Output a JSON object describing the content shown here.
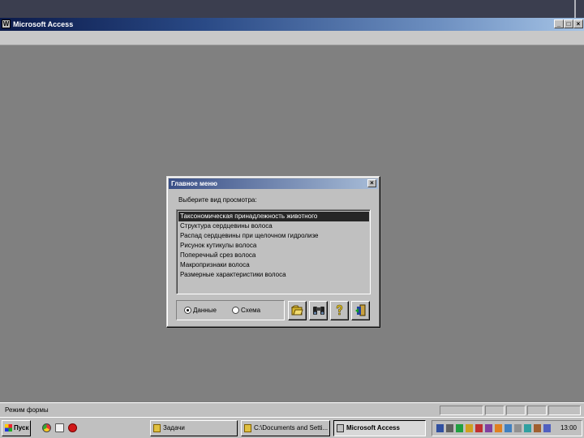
{
  "app": {
    "title": "Microsoft Access",
    "icon_text": "W",
    "buttons": [
      "_",
      "□",
      "×"
    ]
  },
  "dialog": {
    "title": "Главное меню",
    "close": "×",
    "prompt": "Выберите вид просмотра:",
    "items": [
      "Таксономическая принадлежность животного",
      "Структура сердцевины волоса",
      "Распад сердцевины при щелочном гидролизе",
      "Рисунок кутикулы волоса",
      "Поперечный срез волоса",
      "Макропризнаки волоса",
      "Размерные характеристики волоса"
    ],
    "selected_index": 0,
    "radios": [
      {
        "label": "Данные",
        "checked": true
      },
      {
        "label": "Схема",
        "checked": false
      }
    ],
    "tool_icons": [
      "open-folder-icon",
      "binoculars-icon",
      "help-icon",
      "exit-door-icon"
    ]
  },
  "status_bar": {
    "text": "Режим формы"
  },
  "taskbar": {
    "start_label": "Пуск",
    "tasks": [
      {
        "label": "Задачи",
        "active": false
      },
      {
        "label": "C:\\Documents and Setti...",
        "active": false
      },
      {
        "label": "Microsoft Access",
        "active": true
      }
    ],
    "clock": "13:00"
  },
  "colors": {
    "workspace": "#808080",
    "selection": "#262626",
    "title_gradient_start": "#0b1a4a",
    "title_gradient_end": "#a6c4e6"
  }
}
